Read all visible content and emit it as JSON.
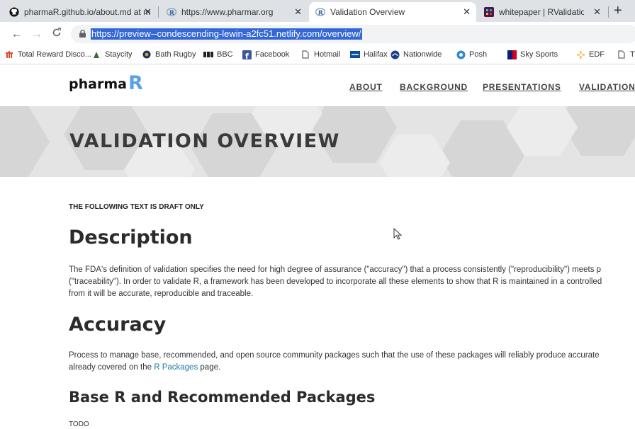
{
  "browser": {
    "tabs": [
      {
        "title": "pharmaR.github.io/about.md at m",
        "favicon": "github-icon"
      },
      {
        "title": "https://www.pharmar.org",
        "favicon": "r-icon"
      },
      {
        "title": "Validation Overview",
        "favicon": "r-icon",
        "active": true
      },
      {
        "title": "whitepaper | RValidationHub Sla",
        "favicon": "slack-icon"
      }
    ],
    "address_url": "https://preview--condescending-lewin-a2fc51.netlify.com/overview/",
    "bookmarks": [
      {
        "label": "Total Reward Disco...",
        "icon": "total-reward-icon"
      },
      {
        "label": "Staycity",
        "icon": "staycity-icon"
      },
      {
        "label": "Bath Rugby",
        "icon": "bath-rugby-icon"
      },
      {
        "label": "BBC",
        "icon": "bbc-icon"
      },
      {
        "label": "Facebook",
        "icon": "facebook-icon"
      },
      {
        "label": "Hotmail",
        "icon": "page-icon"
      },
      {
        "label": "Halifax",
        "icon": "halifax-icon"
      },
      {
        "label": "Nationwide",
        "icon": "nationwide-icon"
      },
      {
        "label": "Posh",
        "icon": "posh-icon"
      },
      {
        "label": "Sky Sports",
        "icon": "sky-sports-icon"
      },
      {
        "label": "EDF",
        "icon": "edf-icon"
      },
      {
        "label": "T",
        "icon": "page-icon"
      }
    ]
  },
  "site": {
    "logo_text": "pharma",
    "logo_mark": "R",
    "nav": [
      "ABOUT",
      "BACKGROUND",
      "PRESENTATIONS",
      "VALIDATION"
    ],
    "hero_title": "VALIDATION OVERVIEW"
  },
  "content": {
    "draft_notice": "THE FOLLOWING TEXT IS DRAFT ONLY",
    "description_heading": "Description",
    "description_lines": [
      "The FDA's definition of validation specifies the need for high degree of assurance (\"accuracy\") that a process consistently (\"reproducibility\") meets p",
      "(\"traceability\"). In order to validate R, a framework has been developed to incorporate all these elements to show that R is maintained in a controlled",
      "from it will be accurate, reproducible and traceable."
    ],
    "accuracy_heading": "Accuracy",
    "accuracy_line1": "Process to manage base, recommended, and open source community packages such that the use of these packages will reliably produce accurate",
    "accuracy_line2_prefix": "already covered on the ",
    "accuracy_link": "R Packages",
    "accuracy_line2_suffix": " page.",
    "base_heading": "Base R and Recommended Packages",
    "todo": "TODO"
  }
}
